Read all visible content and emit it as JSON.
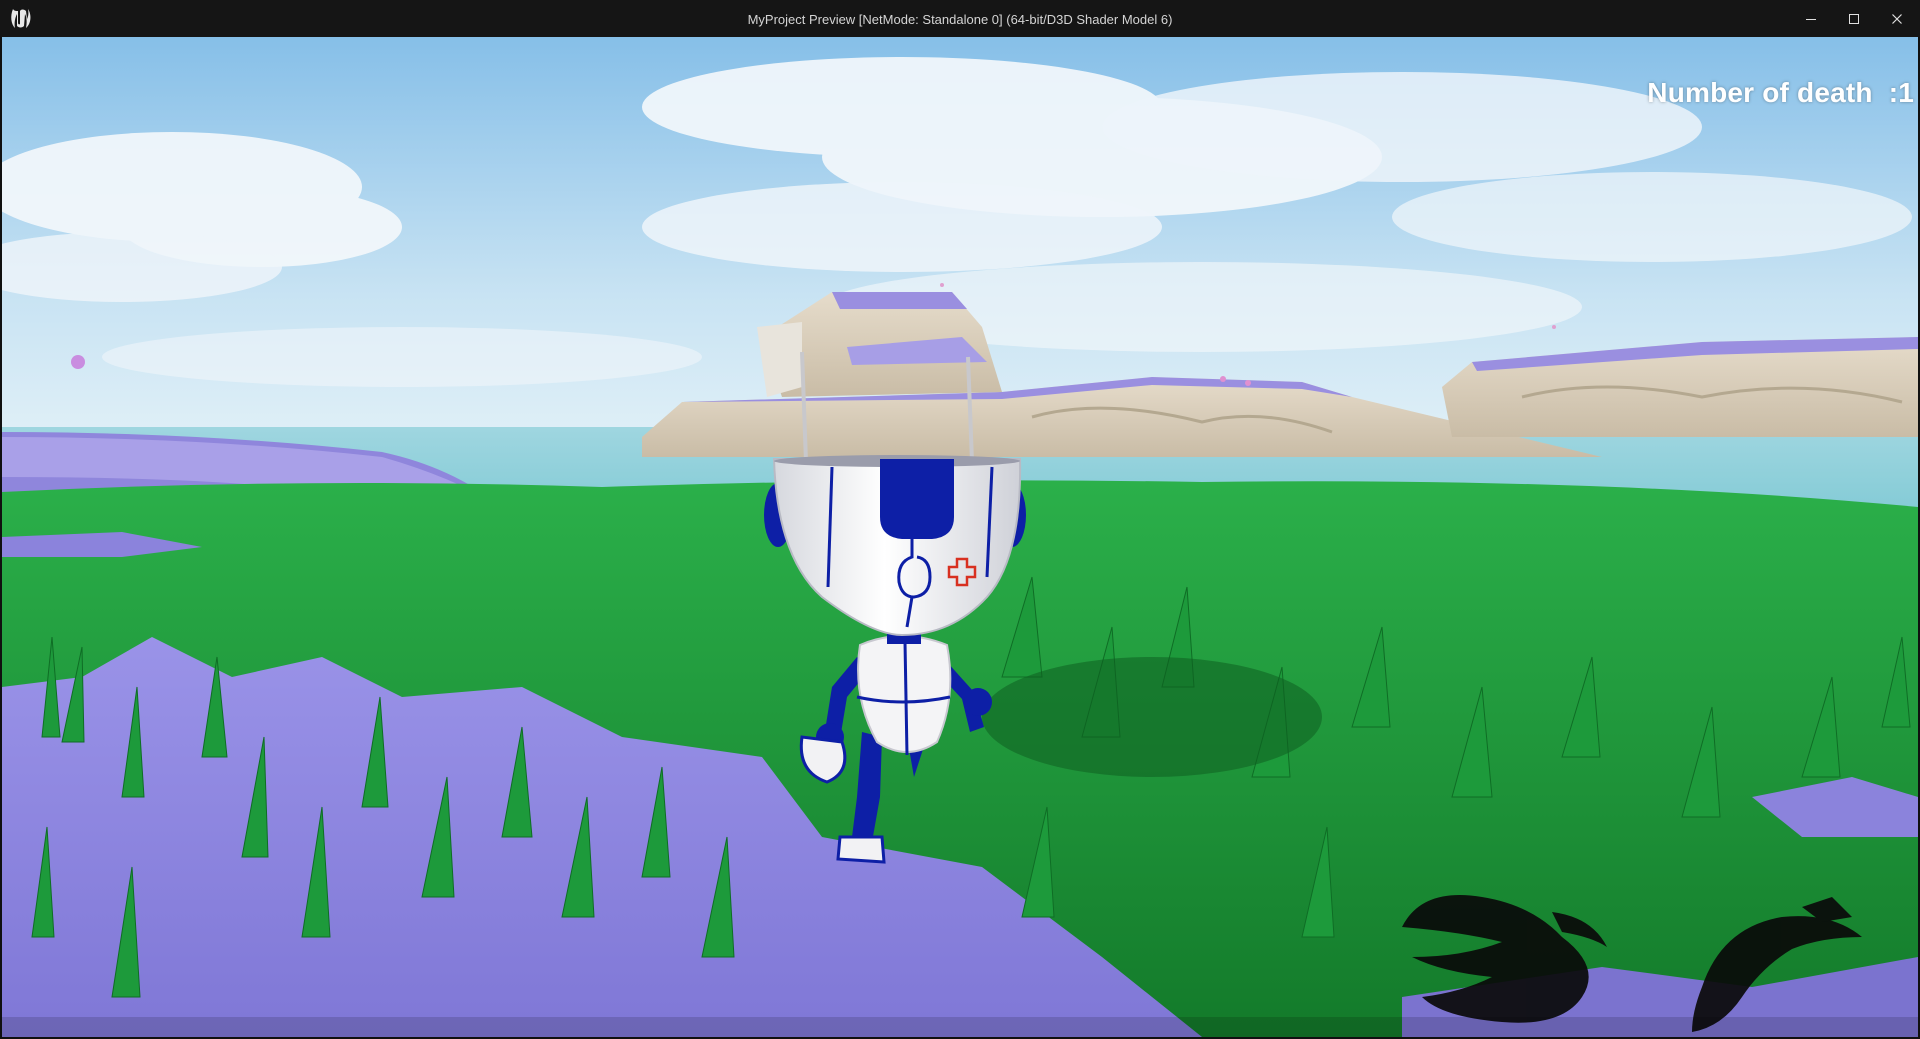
{
  "window": {
    "title": "MyProject Preview [NetMode: Standalone 0]  (64-bit/D3D Shader Model 6)",
    "logo_icon": "unreal-engine-logo-icon",
    "controls": {
      "minimize_icon": "minimize-icon",
      "maximize_icon": "maximize-icon",
      "close_icon": "close-icon"
    }
  },
  "hud": {
    "death_counter": "Number of death  :1",
    "crosshair_icon": "crosshair-icon"
  },
  "scene": {
    "character": "white-blue-robot",
    "colors": {
      "sky_top": "#8fc3e8",
      "sky_bottom": "#d6ecf7",
      "grass": "#1f9a3a",
      "ground": "#8e86e0",
      "water": "#9fd8de",
      "cliff": "#d9cfbf",
      "robot_white": "#f2f2f4",
      "robot_blue": "#0d1fa6",
      "crosshair": "#d83020"
    }
  }
}
